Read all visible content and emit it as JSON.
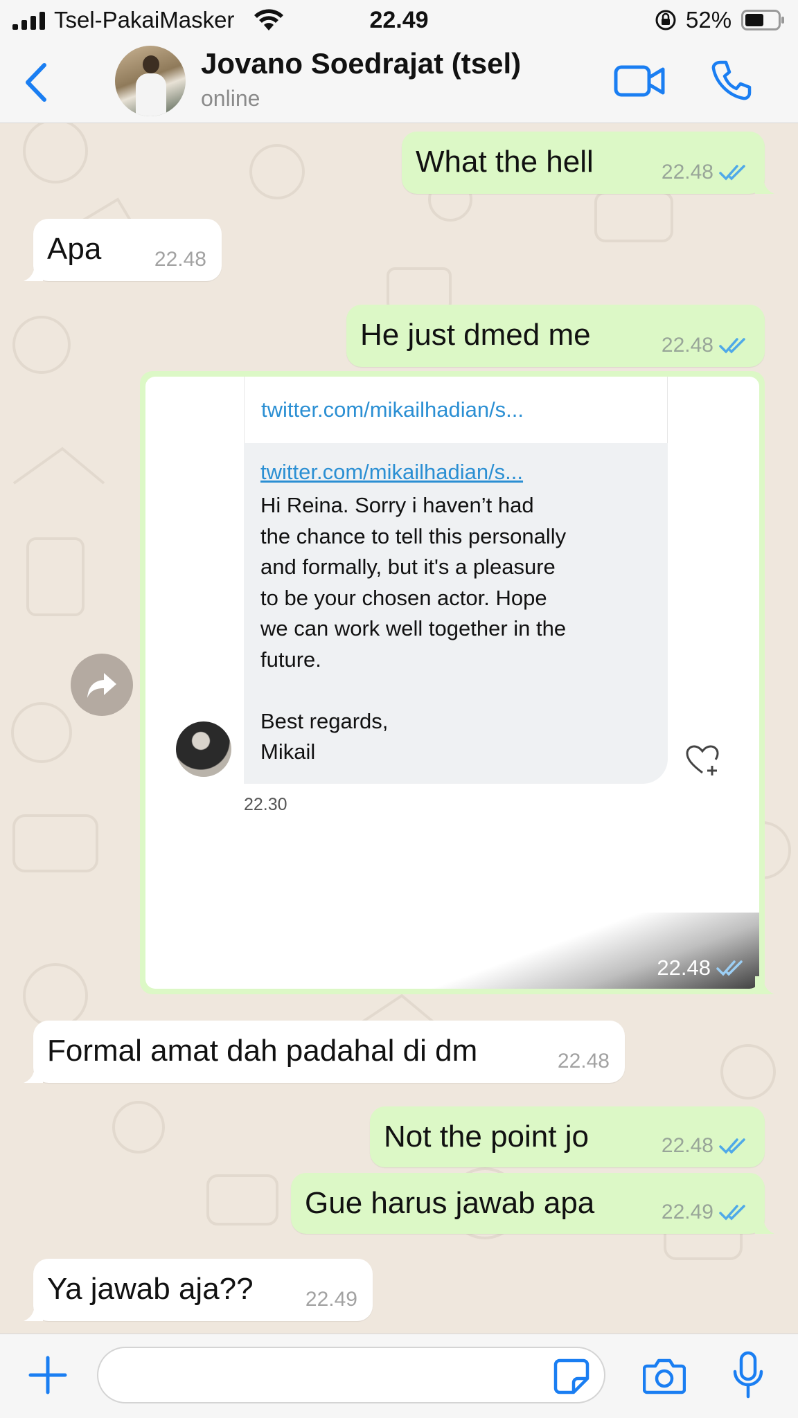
{
  "status_bar": {
    "carrier": "Tsel-PakaiMasker",
    "time": "22.49",
    "battery": "52%"
  },
  "header": {
    "contact_name": "Jovano Soedrajat (tsel)",
    "contact_status": "online"
  },
  "colors": {
    "accent": "#1a7ef2",
    "outgoing_bubble": "#dcf8c6",
    "incoming_bubble": "#ffffff",
    "read_ticks": "#4fa9e8",
    "chat_background": "#efe7dd"
  },
  "messages": [
    {
      "direction": "out",
      "text": "What the hell",
      "time": "22.48",
      "status": "read"
    },
    {
      "direction": "in",
      "text": "Apa",
      "time": "22.48"
    },
    {
      "direction": "out",
      "text": "He just dmed me",
      "time": "22.48",
      "status": "read"
    },
    {
      "direction": "out",
      "type": "image",
      "time": "22.48",
      "status": "read",
      "screenshot": {
        "link_preview": "twitter.com/mikailhadian/s...",
        "dm_link": "twitter.com/mikailhadian/s...",
        "dm_text": "Hi Reina. Sorry i haven’t had\nthe chance to tell this personally\nand formally, but it's a pleasure\nto be your chosen actor. Hope\nwe can work well together in the\nfuture.\n\nBest regards,\nMikail",
        "dm_time": "22.30"
      }
    },
    {
      "direction": "in",
      "text": "Formal amat dah padahal di dm",
      "time": "22.48"
    },
    {
      "direction": "out",
      "text": "Not the point jo",
      "time": "22.48",
      "status": "read"
    },
    {
      "direction": "out",
      "text": "Gue harus jawab apa",
      "time": "22.49",
      "status": "read"
    },
    {
      "direction": "in",
      "text": "Ya jawab aja??",
      "time": "22.49"
    }
  ],
  "input_bar": {
    "placeholder": ""
  },
  "icons": {
    "back": "chevron-left-icon",
    "video": "video-camera-icon",
    "call": "phone-icon",
    "forward": "forward-arrow-icon",
    "add": "plus-icon",
    "sticker": "sticker-icon",
    "camera": "camera-icon",
    "voice": "microphone-icon"
  }
}
